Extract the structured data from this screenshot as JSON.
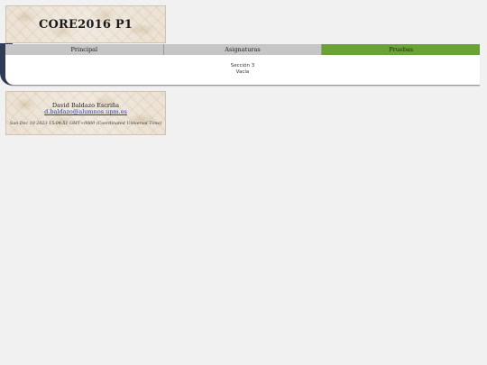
{
  "header": {
    "title": "CORE2016 P1"
  },
  "nav": {
    "tabs": [
      {
        "label": "Principal",
        "active": false
      },
      {
        "label": "Asignaturas",
        "active": false
      },
      {
        "label": "Pruebas",
        "active": true
      }
    ],
    "active_color": "#6aa333",
    "inactive_color": "#c6c6c6"
  },
  "content": {
    "section_title": "Sección 3",
    "section_text": "Vacía"
  },
  "footer": {
    "name": "David Baldazo Escriña",
    "email": "d.baldazo@alumnos.upm.es",
    "date": "Sun Dec 10 2023 15:04:51 GMT+0000 (Coordinated Universal Time)"
  },
  "colors": {
    "accent_dark": "#2f3b57",
    "link": "#1a3fb8"
  }
}
